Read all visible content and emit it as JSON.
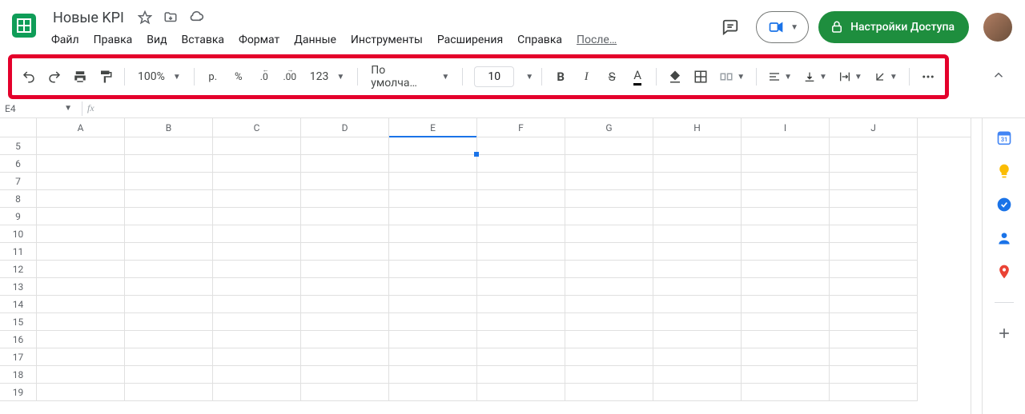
{
  "doc": {
    "title": "Новые KPI"
  },
  "menu": {
    "file": "Файл",
    "edit": "Правка",
    "view": "Вид",
    "insert": "Вставка",
    "format": "Формат",
    "data": "Данные",
    "tools": "Инструменты",
    "extensions": "Расширения",
    "help": "Справка",
    "last_edit": "После…"
  },
  "share": {
    "label": "Настройки Доступа"
  },
  "toolbar": {
    "zoom": "100%",
    "currency": "р.",
    "percent": "%",
    "dec_dec": ".0",
    "inc_dec": ".00",
    "more_formats": "123",
    "font": "По умолча…",
    "font_size": "10",
    "bold": "B",
    "italic": "I",
    "strike": "S"
  },
  "namebox": {
    "cell": "E4",
    "fx": "fx"
  },
  "columns": [
    "A",
    "B",
    "C",
    "D",
    "E",
    "F",
    "G",
    "H",
    "I",
    "J"
  ],
  "rows": [
    5,
    6,
    7,
    8,
    9,
    10,
    11,
    12,
    13,
    14,
    15,
    16,
    17,
    18,
    19
  ],
  "active_col_index": 4,
  "sidepanel": {
    "calendar_day": "31"
  }
}
